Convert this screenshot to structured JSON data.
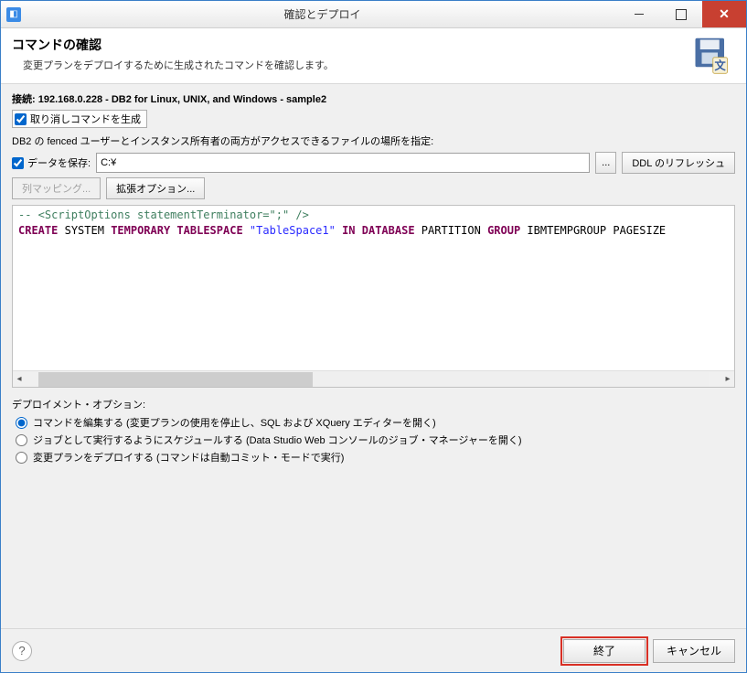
{
  "window": {
    "title": "確認とデプロイ"
  },
  "header": {
    "title": "コマンドの確認",
    "subtitle": "変更プランをデプロイするために生成されたコマンドを確認します。"
  },
  "connection": {
    "label": "接続: ",
    "value": "192.168.0.228 - DB2 for Linux, UNIX, and Windows - sample2"
  },
  "checkboxes": {
    "undo_generate": "取り消しコマンドを生成",
    "save_data": "データを保存:"
  },
  "fenced_label": "DB2 の fenced ユーザーとインスタンス所有者の両方がアクセスできるファイルの場所を指定:",
  "path_value": "C:¥",
  "buttons": {
    "browse": "...",
    "ddl_refresh": "DDL のリフレッシュ",
    "col_mapping": "列マッピング...",
    "ext_options": "拡張オプション...",
    "finish": "終了",
    "cancel": "キャンセル"
  },
  "code": {
    "line1_comment": "-- <ScriptOptions statementTerminator=\";\" />",
    "line2": {
      "create": "CREATE",
      "system": "SYSTEM",
      "temporary_tablespace": "TEMPORARY TABLESPACE",
      "name": "\"TableSpace1\"",
      "in_database": "IN DATABASE",
      "partition": "PARTITION",
      "group": "GROUP",
      "rest": "IBMTEMPGROUP PAGESIZE"
    }
  },
  "deploy": {
    "section_title": "デプロイメント・オプション:",
    "opt_edit": "コマンドを編集する (変更プランの使用を停止し、SQL および XQuery エディターを開く)",
    "opt_schedule": "ジョブとして実行するようにスケジュールする (Data Studio Web コンソールのジョブ・マネージャーを開く)",
    "opt_deploy": "変更プランをデプロイする (コマンドは自動コミット・モードで実行)"
  }
}
